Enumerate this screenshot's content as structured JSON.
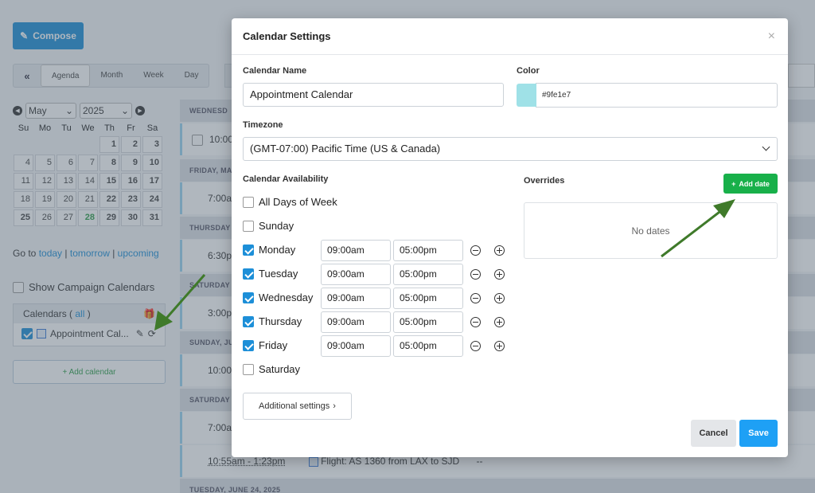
{
  "app": {
    "compose_label": "Compose",
    "views": [
      "Agenda",
      "Month",
      "Week",
      "Day"
    ],
    "collapse_icon": "«"
  },
  "minical": {
    "month": "May",
    "year": "2025",
    "dows": [
      "Su",
      "Mo",
      "Tu",
      "We",
      "Th",
      "Fr",
      "Sa"
    ],
    "weeks": [
      [
        "",
        "",
        "",
        "",
        "1",
        "2",
        "3"
      ],
      [
        "4",
        "5",
        "6",
        "7",
        "8",
        "9",
        "10"
      ],
      [
        "11",
        "12",
        "13",
        "14",
        "15",
        "16",
        "17"
      ],
      [
        "18",
        "19",
        "20",
        "21",
        "22",
        "23",
        "24"
      ],
      [
        "25",
        "26",
        "27",
        "28",
        "29",
        "30",
        "31"
      ]
    ],
    "today": "28",
    "goto_label": "Go to",
    "goto_today": "today",
    "goto_tomorrow": "tomorrow",
    "goto_upcoming": "upcoming"
  },
  "sidebar": {
    "show_campaign": "Show Campaign Calendars",
    "calendars_label": "Calendars (",
    "calendars_all": "all",
    "calendars_close": ")",
    "calendar_item": "Appointment Cal...",
    "add_calendar": "+ Add calendar"
  },
  "agenda": {
    "headers": [
      "WEDNESD",
      "FRIDAY, MA",
      "THURSDAY",
      "SATURDAY",
      "SUNDAY, JU",
      "SATURDAY",
      "TUESDAY, JUNE 24, 2025"
    ],
    "rows": [
      "10:00",
      "7:00a",
      "6:30p",
      "3:00p",
      "10:00",
      "7:00a",
      "10:55am - 1:23pm"
    ],
    "flight": "Flight: AS 1360 from LAX to SJD",
    "flight_tail": "--"
  },
  "modal": {
    "title": "Calendar Settings",
    "close": "×",
    "name_label": "Calendar Name",
    "name_value": "Appointment Calendar",
    "color_label": "Color",
    "color_value": "#9fe1e7",
    "timezone_label": "Timezone",
    "timezone_value": "(GMT-07:00) Pacific Time (US & Canada)",
    "availability_label": "Calendar Availability",
    "all_days": "All Days of Week",
    "days": [
      {
        "name": "Sunday",
        "checked": false
      },
      {
        "name": "Monday",
        "checked": true,
        "start": "09:00am",
        "end": "05:00pm"
      },
      {
        "name": "Tuesday",
        "checked": true,
        "start": "09:00am",
        "end": "05:00pm"
      },
      {
        "name": "Wednesday",
        "checked": true,
        "start": "09:00am",
        "end": "05:00pm"
      },
      {
        "name": "Thursday",
        "checked": true,
        "start": "09:00am",
        "end": "05:00pm"
      },
      {
        "name": "Friday",
        "checked": true,
        "start": "09:00am",
        "end": "05:00pm"
      },
      {
        "name": "Saturday",
        "checked": false
      }
    ],
    "overrides_label": "Overrides",
    "add_date": "Add date",
    "no_dates": "No dates",
    "additional_settings": "Additional settings",
    "cancel": "Cancel",
    "save": "Save"
  },
  "colors": {
    "primary": "#1ea0f5",
    "green": "#18b04a",
    "swatch": "#9fe1e7",
    "arrow": "#3f7a2a"
  }
}
